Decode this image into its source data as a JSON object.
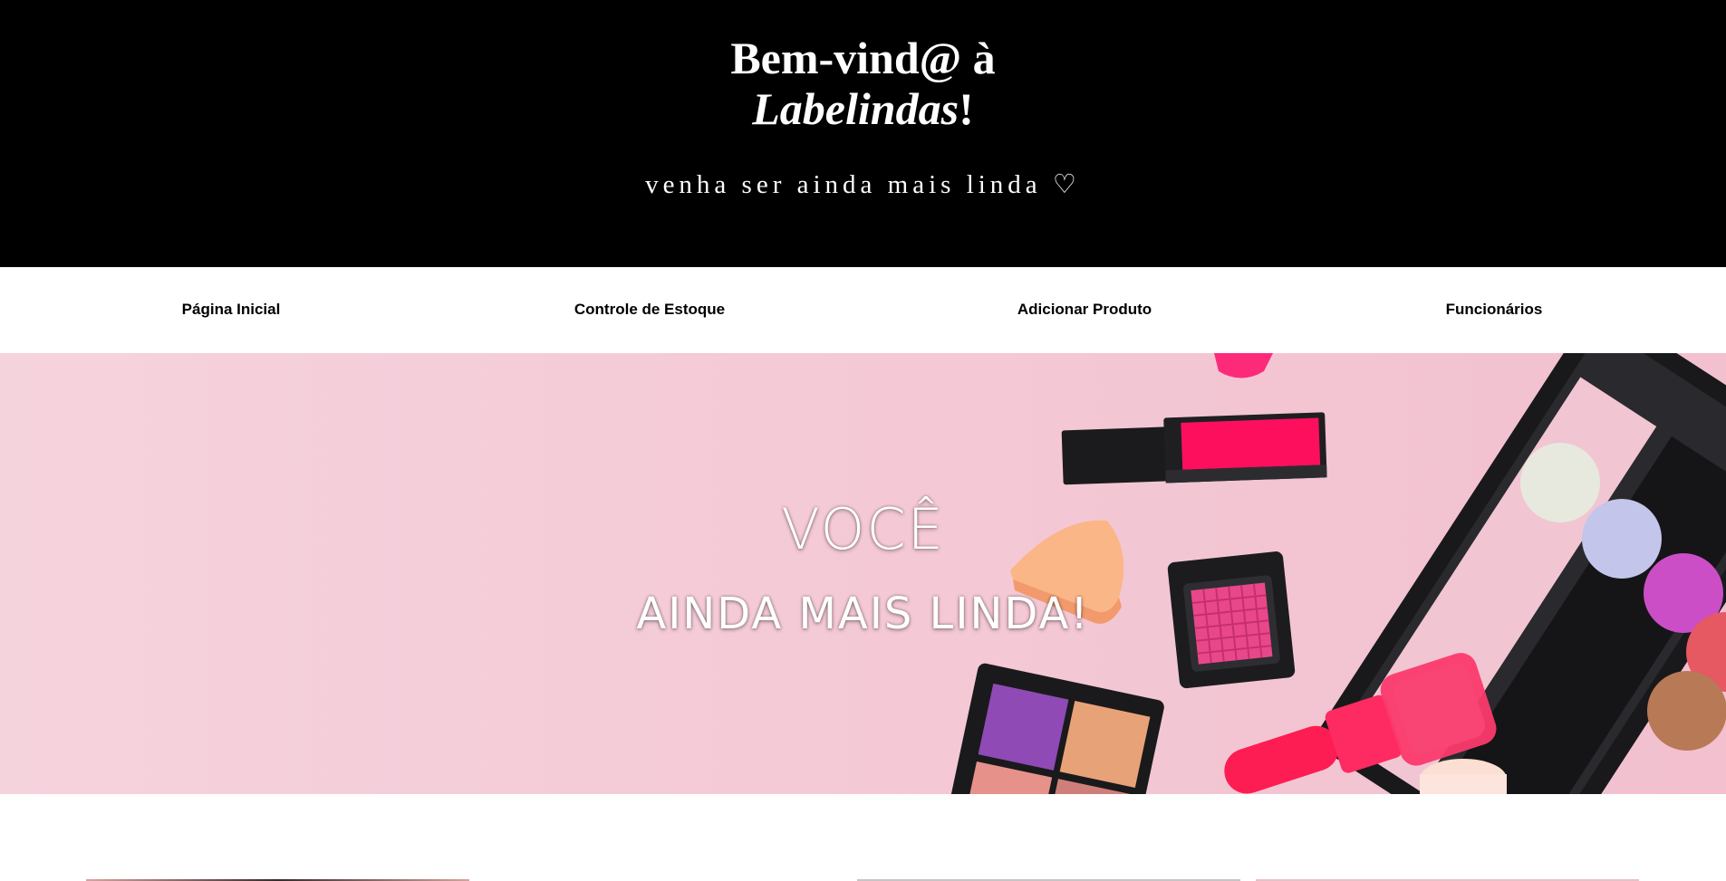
{
  "header": {
    "title_line1": "Bem-vind@ à",
    "title_brand": "Labelindas",
    "title_suffix": "!",
    "tagline": "venha ser ainda mais linda ♡"
  },
  "nav": {
    "items": [
      {
        "label": "Página Inicial"
      },
      {
        "label": "Controle de Estoque"
      },
      {
        "label": "Adicionar Produto"
      },
      {
        "label": "Funcionários"
      }
    ]
  },
  "hero": {
    "line1": "VOCÊ",
    "line2": "AINDA MAIS LINDA!",
    "image_description_icon": "makeup-products-image"
  },
  "colors": {
    "header_bg": "#000000",
    "hero_pink": "#f4cad6",
    "accent_pink": "#fd1e65"
  }
}
